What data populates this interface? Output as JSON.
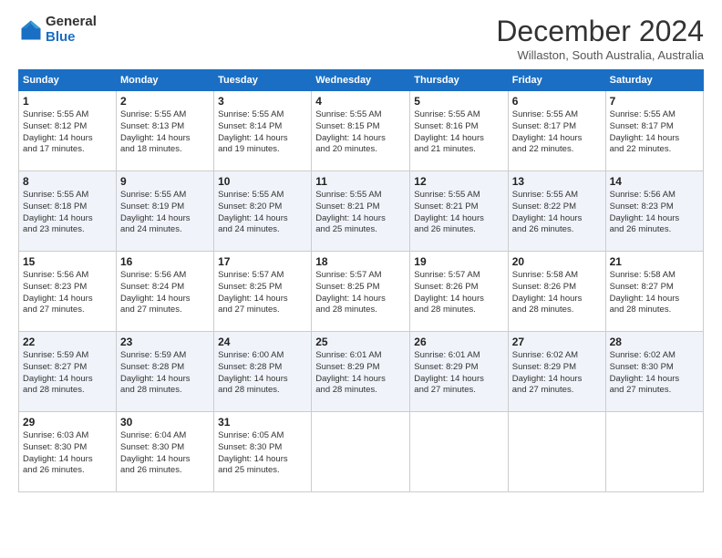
{
  "logo": {
    "general": "General",
    "blue": "Blue"
  },
  "title": "December 2024",
  "subtitle": "Willaston, South Australia, Australia",
  "days_of_week": [
    "Sunday",
    "Monday",
    "Tuesday",
    "Wednesday",
    "Thursday",
    "Friday",
    "Saturday"
  ],
  "weeks": [
    [
      {
        "day": "1",
        "info": "Sunrise: 5:55 AM\nSunset: 8:12 PM\nDaylight: 14 hours\nand 17 minutes."
      },
      {
        "day": "2",
        "info": "Sunrise: 5:55 AM\nSunset: 8:13 PM\nDaylight: 14 hours\nand 18 minutes."
      },
      {
        "day": "3",
        "info": "Sunrise: 5:55 AM\nSunset: 8:14 PM\nDaylight: 14 hours\nand 19 minutes."
      },
      {
        "day": "4",
        "info": "Sunrise: 5:55 AM\nSunset: 8:15 PM\nDaylight: 14 hours\nand 20 minutes."
      },
      {
        "day": "5",
        "info": "Sunrise: 5:55 AM\nSunset: 8:16 PM\nDaylight: 14 hours\nand 21 minutes."
      },
      {
        "day": "6",
        "info": "Sunrise: 5:55 AM\nSunset: 8:17 PM\nDaylight: 14 hours\nand 22 minutes."
      },
      {
        "day": "7",
        "info": "Sunrise: 5:55 AM\nSunset: 8:17 PM\nDaylight: 14 hours\nand 22 minutes."
      }
    ],
    [
      {
        "day": "8",
        "info": "Sunrise: 5:55 AM\nSunset: 8:18 PM\nDaylight: 14 hours\nand 23 minutes."
      },
      {
        "day": "9",
        "info": "Sunrise: 5:55 AM\nSunset: 8:19 PM\nDaylight: 14 hours\nand 24 minutes."
      },
      {
        "day": "10",
        "info": "Sunrise: 5:55 AM\nSunset: 8:20 PM\nDaylight: 14 hours\nand 24 minutes."
      },
      {
        "day": "11",
        "info": "Sunrise: 5:55 AM\nSunset: 8:21 PM\nDaylight: 14 hours\nand 25 minutes."
      },
      {
        "day": "12",
        "info": "Sunrise: 5:55 AM\nSunset: 8:21 PM\nDaylight: 14 hours\nand 26 minutes."
      },
      {
        "day": "13",
        "info": "Sunrise: 5:55 AM\nSunset: 8:22 PM\nDaylight: 14 hours\nand 26 minutes."
      },
      {
        "day": "14",
        "info": "Sunrise: 5:56 AM\nSunset: 8:23 PM\nDaylight: 14 hours\nand 26 minutes."
      }
    ],
    [
      {
        "day": "15",
        "info": "Sunrise: 5:56 AM\nSunset: 8:23 PM\nDaylight: 14 hours\nand 27 minutes."
      },
      {
        "day": "16",
        "info": "Sunrise: 5:56 AM\nSunset: 8:24 PM\nDaylight: 14 hours\nand 27 minutes."
      },
      {
        "day": "17",
        "info": "Sunrise: 5:57 AM\nSunset: 8:25 PM\nDaylight: 14 hours\nand 27 minutes."
      },
      {
        "day": "18",
        "info": "Sunrise: 5:57 AM\nSunset: 8:25 PM\nDaylight: 14 hours\nand 28 minutes."
      },
      {
        "day": "19",
        "info": "Sunrise: 5:57 AM\nSunset: 8:26 PM\nDaylight: 14 hours\nand 28 minutes."
      },
      {
        "day": "20",
        "info": "Sunrise: 5:58 AM\nSunset: 8:26 PM\nDaylight: 14 hours\nand 28 minutes."
      },
      {
        "day": "21",
        "info": "Sunrise: 5:58 AM\nSunset: 8:27 PM\nDaylight: 14 hours\nand 28 minutes."
      }
    ],
    [
      {
        "day": "22",
        "info": "Sunrise: 5:59 AM\nSunset: 8:27 PM\nDaylight: 14 hours\nand 28 minutes."
      },
      {
        "day": "23",
        "info": "Sunrise: 5:59 AM\nSunset: 8:28 PM\nDaylight: 14 hours\nand 28 minutes."
      },
      {
        "day": "24",
        "info": "Sunrise: 6:00 AM\nSunset: 8:28 PM\nDaylight: 14 hours\nand 28 minutes."
      },
      {
        "day": "25",
        "info": "Sunrise: 6:01 AM\nSunset: 8:29 PM\nDaylight: 14 hours\nand 28 minutes."
      },
      {
        "day": "26",
        "info": "Sunrise: 6:01 AM\nSunset: 8:29 PM\nDaylight: 14 hours\nand 27 minutes."
      },
      {
        "day": "27",
        "info": "Sunrise: 6:02 AM\nSunset: 8:29 PM\nDaylight: 14 hours\nand 27 minutes."
      },
      {
        "day": "28",
        "info": "Sunrise: 6:02 AM\nSunset: 8:30 PM\nDaylight: 14 hours\nand 27 minutes."
      }
    ],
    [
      {
        "day": "29",
        "info": "Sunrise: 6:03 AM\nSunset: 8:30 PM\nDaylight: 14 hours\nand 26 minutes."
      },
      {
        "day": "30",
        "info": "Sunrise: 6:04 AM\nSunset: 8:30 PM\nDaylight: 14 hours\nand 26 minutes."
      },
      {
        "day": "31",
        "info": "Sunrise: 6:05 AM\nSunset: 8:30 PM\nDaylight: 14 hours\nand 25 minutes."
      },
      {
        "day": "",
        "info": ""
      },
      {
        "day": "",
        "info": ""
      },
      {
        "day": "",
        "info": ""
      },
      {
        "day": "",
        "info": ""
      }
    ]
  ]
}
